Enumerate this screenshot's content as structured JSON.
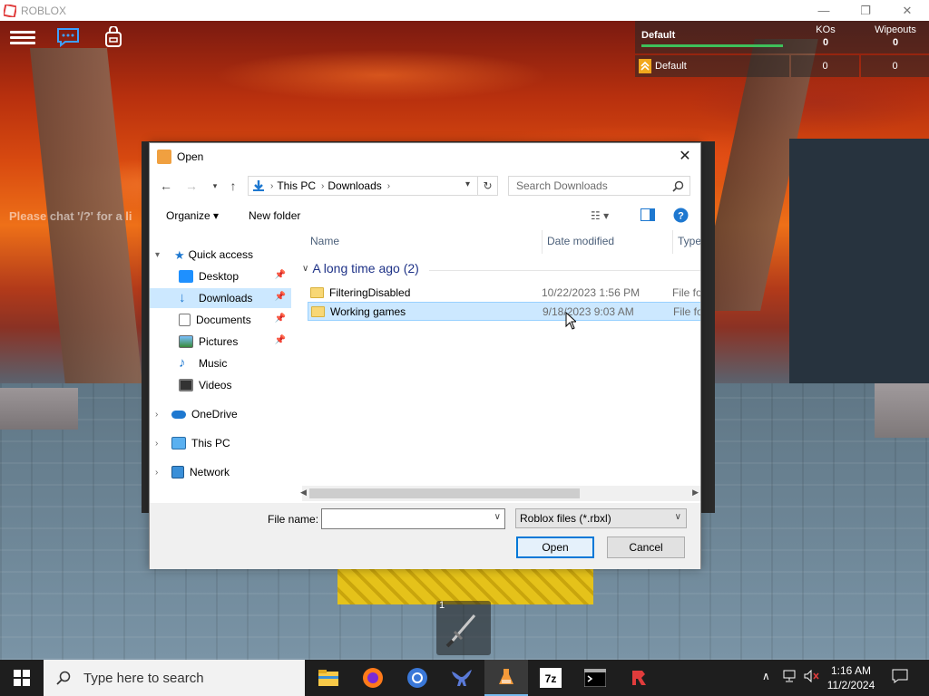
{
  "window": {
    "title": "ROBLOX"
  },
  "game": {
    "chat_hint": "Please chat '/?' for a li",
    "leaderboard": {
      "team": "Default",
      "col1_label": "KOs",
      "col1_value": "0",
      "col2_label": "Wipeouts",
      "col2_value": "0",
      "player_name": "Default",
      "player_kos": "0",
      "player_wipeouts": "0"
    },
    "hotbar": {
      "slot_number": "1"
    }
  },
  "dialog": {
    "title": "Open",
    "address": {
      "crumbs": [
        "This PC",
        "Downloads"
      ]
    },
    "search_placeholder": "Search Downloads",
    "organize_label": "Organize ▾",
    "new_folder_label": "New folder",
    "nav": {
      "quick_access": "Quick access",
      "items": [
        {
          "label": "Desktop",
          "icon": "desktop-icon"
        },
        {
          "label": "Downloads",
          "icon": "downloads-icon"
        },
        {
          "label": "Documents",
          "icon": "documents-icon"
        },
        {
          "label": "Pictures",
          "icon": "pictures-icon"
        },
        {
          "label": "Music",
          "icon": "music-icon"
        },
        {
          "label": "Videos",
          "icon": "videos-icon"
        }
      ],
      "onedrive": "OneDrive",
      "this_pc": "This PC",
      "network": "Network"
    },
    "columns": {
      "name": "Name",
      "date": "Date modified",
      "type": "Type"
    },
    "group": "A long time ago (2)",
    "files": [
      {
        "name": "FilteringDisabled",
        "date": "10/22/2023 1:56 PM",
        "type": "File fo"
      },
      {
        "name": "Working games",
        "date": "9/18/2023 9:03 AM",
        "type": "File fo"
      }
    ],
    "file_name_label": "File name:",
    "file_name_value": "",
    "file_type": "Roblox files (*.rbxl)",
    "open_label": "Open",
    "cancel_label": "Cancel"
  },
  "taskbar": {
    "search_placeholder": "Type here to search",
    "time": "1:16 AM",
    "date": "11/2/2024"
  }
}
